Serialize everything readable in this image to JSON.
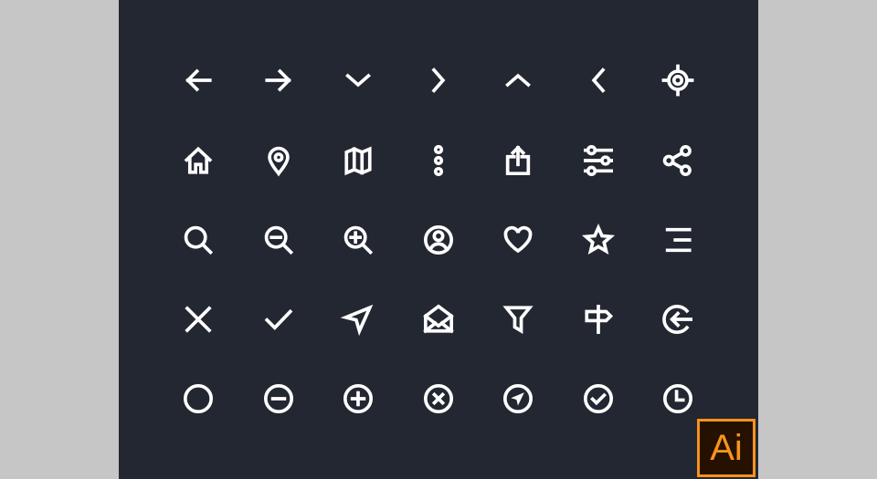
{
  "colors": {
    "outer_background": "#c6c6c6",
    "panel_background": "#232732",
    "icon_color": "#ffffff",
    "badge_accent": "#f7931e",
    "badge_background": "#261100"
  },
  "icon_grid": {
    "rows": 5,
    "columns": 7,
    "icons": [
      [
        "arrow-left",
        "arrow-right",
        "chevron-down",
        "chevron-right",
        "chevron-up",
        "chevron-left",
        "target"
      ],
      [
        "home",
        "map-pin",
        "map",
        "more-vertical",
        "share-upload",
        "sliders",
        "share-nodes"
      ],
      [
        "search",
        "zoom-out",
        "zoom-in",
        "user-circle",
        "heart",
        "star",
        "menu-right"
      ],
      [
        "close",
        "check",
        "navigation",
        "mail-open",
        "filter",
        "signpost",
        "log-in-circle"
      ],
      [
        "circle",
        "minus-circle",
        "plus-circle",
        "x-circle",
        "navigation-circle",
        "check-circle",
        "clock"
      ]
    ]
  },
  "badge": {
    "label": "Ai",
    "icon": "adobe-illustrator-icon"
  }
}
